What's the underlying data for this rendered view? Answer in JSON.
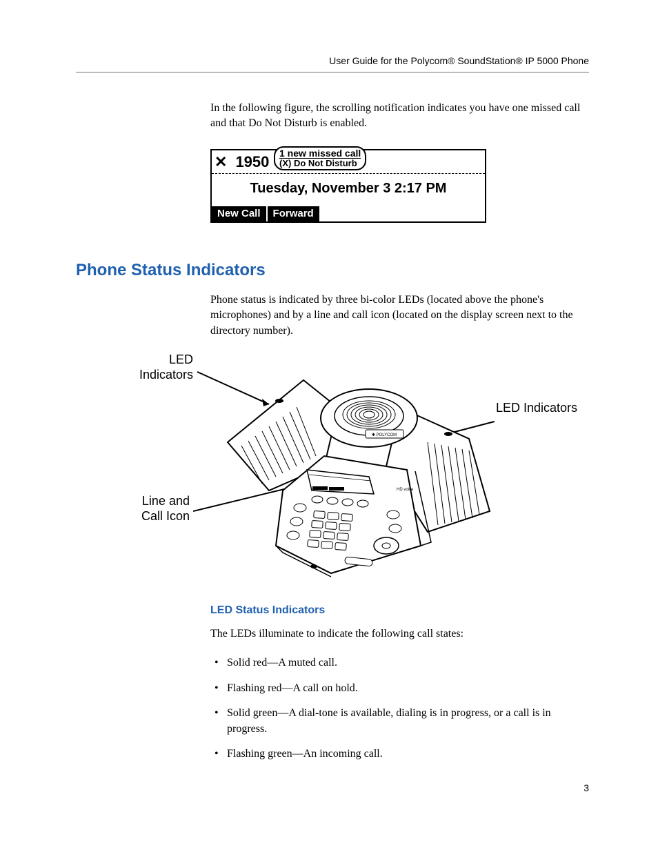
{
  "header": "User Guide for the Polycom® SoundStation® IP 5000 Phone",
  "intro": "In the following figure, the scrolling notification indicates you have one missed call and that Do Not Disturb is enabled.",
  "screen": {
    "extension": "1950",
    "bubble_line1": "1 new missed call",
    "bubble_line2": "(X) Do Not Disturb",
    "datetime": "Tuesday, November 3   2:17 PM",
    "softkey1": "New Call",
    "softkey2": "Forward"
  },
  "section_heading": "Phone Status Indicators",
  "section_body": "Phone status is indicated by three bi-color LEDs (located above the phone's microphones) and by a line and call icon (located on the display screen next to the directory number).",
  "callouts": {
    "led": "LED Indicators",
    "line_icon": "Line and Call Icon"
  },
  "sub_heading": "LED Status Indicators",
  "led_intro": "The LEDs illuminate to indicate the following call states:",
  "bullets": [
    "Solid red—A muted call.",
    "Flashing red—A call on hold.",
    "Solid green—A dial-tone is available, dialing is in progress, or a call is in progress.",
    "Flashing green—An incoming call."
  ],
  "page_number": "3"
}
